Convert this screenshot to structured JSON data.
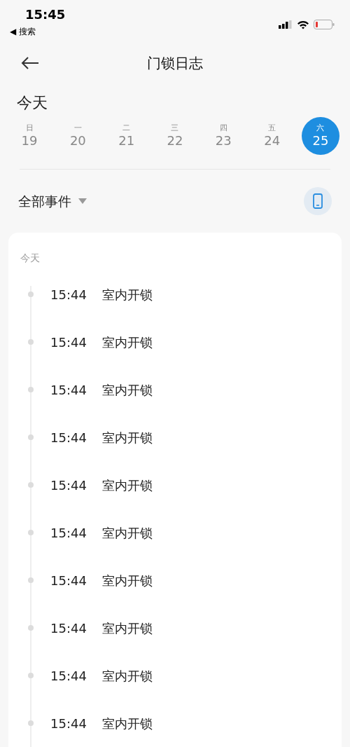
{
  "status_bar": {
    "time": "15:45",
    "back_label": "◀ 搜索"
  },
  "header": {
    "title": "门锁日志"
  },
  "date_heading": "今天",
  "week": [
    {
      "weekday": "日",
      "day": "19",
      "selected": false
    },
    {
      "weekday": "一",
      "day": "20",
      "selected": false
    },
    {
      "weekday": "二",
      "day": "21",
      "selected": false
    },
    {
      "weekday": "三",
      "day": "22",
      "selected": false
    },
    {
      "weekday": "四",
      "day": "23",
      "selected": false
    },
    {
      "weekday": "五",
      "day": "24",
      "selected": false
    },
    {
      "weekday": "六",
      "day": "25",
      "selected": true
    }
  ],
  "filter": {
    "label": "全部事件"
  },
  "log": {
    "section_label": "今天",
    "events": [
      {
        "time": "15:44",
        "event": "室内开锁"
      },
      {
        "time": "15:44",
        "event": "室内开锁"
      },
      {
        "time": "15:44",
        "event": "室内开锁"
      },
      {
        "time": "15:44",
        "event": "室内开锁"
      },
      {
        "time": "15:44",
        "event": "室内开锁"
      },
      {
        "time": "15:44",
        "event": "室内开锁"
      },
      {
        "time": "15:44",
        "event": "室内开锁"
      },
      {
        "time": "15:44",
        "event": "室内开锁"
      },
      {
        "time": "15:44",
        "event": "室内开锁"
      },
      {
        "time": "15:44",
        "event": "室内开锁"
      }
    ]
  }
}
